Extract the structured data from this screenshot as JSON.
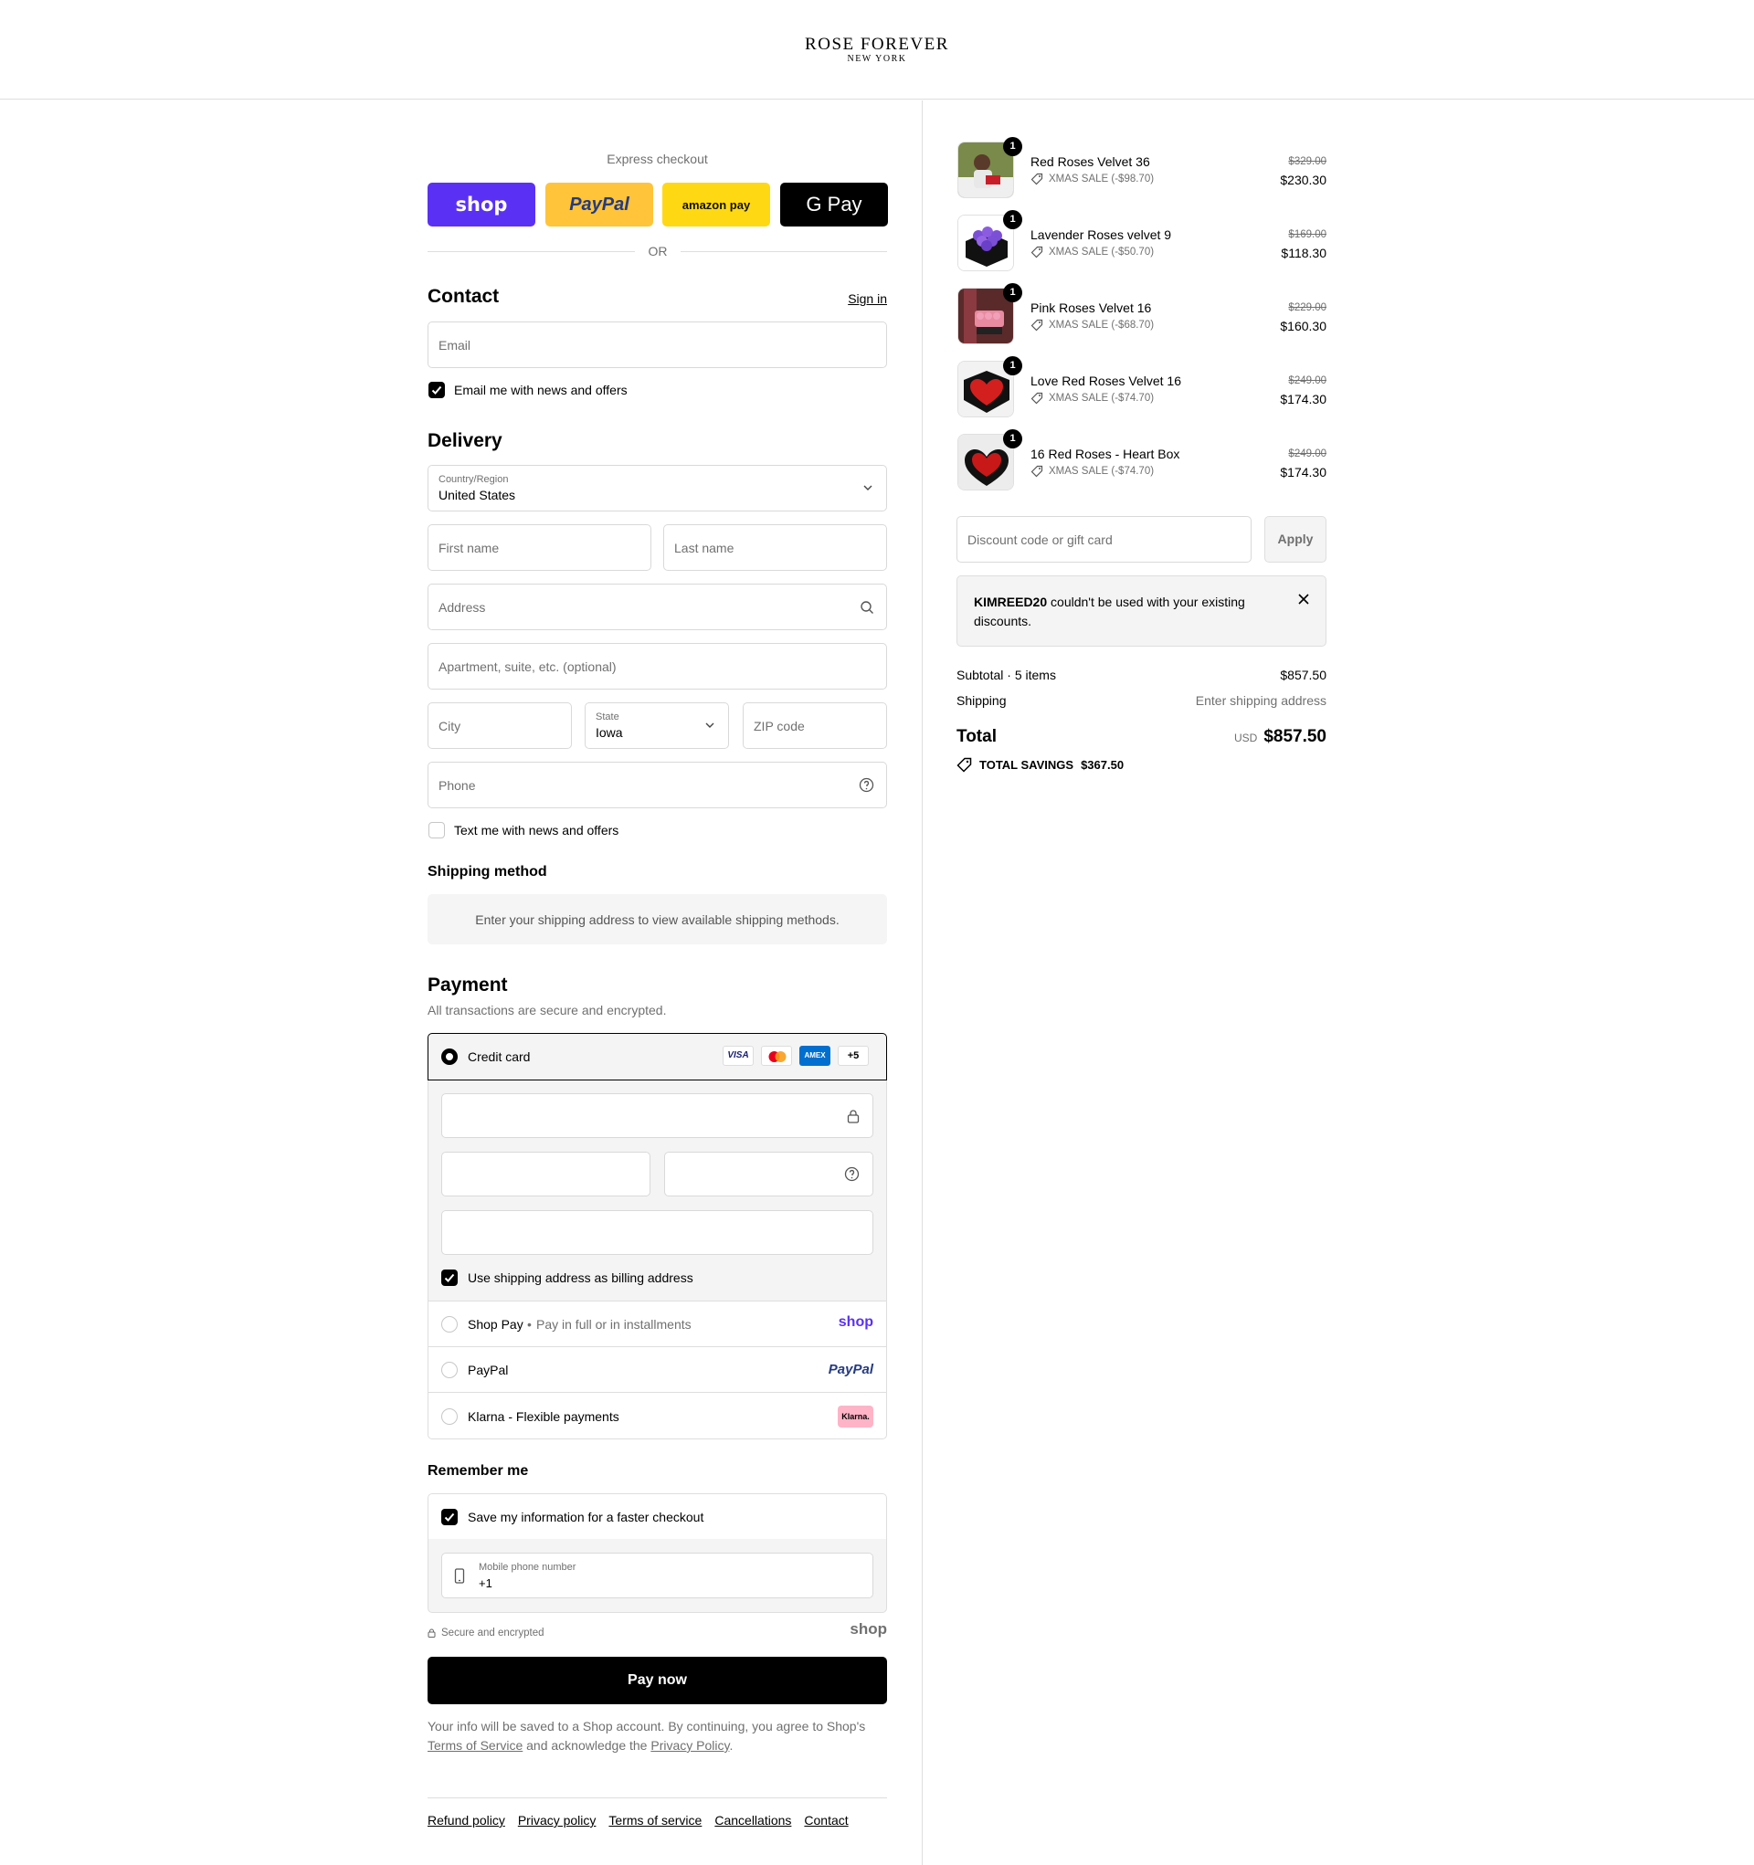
{
  "store": {
    "name": "ROSE FOREVER",
    "sub": "NEW YORK"
  },
  "express": {
    "title": "Express checkout",
    "or": "OR",
    "buttons": [
      {
        "label": "shop",
        "color": "#5a31f4"
      },
      {
        "label": "PayPal",
        "color": "#ffc439"
      },
      {
        "label": "amazon pay",
        "color": "#ffd814"
      },
      {
        "label": "G Pay",
        "color": "#000000"
      }
    ]
  },
  "contact": {
    "title": "Contact",
    "signin": "Sign in",
    "email_placeholder": "Email",
    "news_label": "Email me with news and offers"
  },
  "delivery": {
    "title": "Delivery",
    "country_label": "Country/Region",
    "country_value": "United States",
    "first_name": "First name",
    "last_name": "Last name",
    "address": "Address",
    "apartment": "Apartment, suite, etc. (optional)",
    "city": "City",
    "state_label": "State",
    "state_value": "Iowa",
    "zip": "ZIP code",
    "phone": "Phone",
    "text_label": "Text me with news and offers"
  },
  "shipping": {
    "title": "Shipping method",
    "notice": "Enter your shipping address to view available shipping methods."
  },
  "payment": {
    "title": "Payment",
    "subtitle": "All transactions are secure and encrypted.",
    "credit_card": "Credit card",
    "card_logos": [
      "VISA",
      "MC",
      "AMEX",
      "+5"
    ],
    "billing_label": "Use shipping address as billing address",
    "shoppay": "Shop Pay",
    "shoppay_sub": "Pay in full or in installments",
    "shoppay_logo": "shop",
    "paypal": "PayPal",
    "paypal_logo": "PayPal",
    "klarna": "Klarna - Flexible payments",
    "klarna_logo": "Klarna."
  },
  "remember": {
    "title": "Remember me",
    "save_label": "Save my information for a faster checkout",
    "mobile_label": "Mobile phone number",
    "mobile_value": "+1",
    "secure": "Secure and encrypted",
    "shop_logo": "shop"
  },
  "paynow": "Pay now",
  "legal": {
    "line1": "Your info will be saved to a Shop account. By continuing, you agree to Shop's",
    "terms": "Terms of Service",
    "middle": " and acknowledge the ",
    "privacy": "Privacy Policy",
    "end": "."
  },
  "footer_links": [
    "Refund policy",
    "Privacy policy",
    "Terms of service",
    "Cancellations",
    "Contact"
  ],
  "cart": {
    "items": [
      {
        "name": "Red Roses Velvet 36",
        "sale": "XMAS SALE (-$98.70)",
        "old": "$329.00",
        "price": "$230.30",
        "qty": "1"
      },
      {
        "name": "Lavender Roses velvet 9",
        "sale": "XMAS SALE (-$50.70)",
        "old": "$169.00",
        "price": "$118.30",
        "qty": "1"
      },
      {
        "name": "Pink Roses Velvet 16",
        "sale": "XMAS SALE (-$68.70)",
        "old": "$229.00",
        "price": "$160.30",
        "qty": "1"
      },
      {
        "name": "Love Red Roses Velvet 16",
        "sale": "XMAS SALE (-$74.70)",
        "old": "$249.00",
        "price": "$174.30",
        "qty": "1"
      },
      {
        "name": "16 Red Roses - Heart Box",
        "sale": "XMAS SALE (-$74.70)",
        "old": "$249.00",
        "price": "$174.30",
        "qty": "1"
      }
    ],
    "discount_placeholder": "Discount code or gift card",
    "apply": "Apply",
    "error_code": "KIMREED20",
    "error_msg": " couldn't be used with your existing discounts.",
    "subtotal_label": "Subtotal · 5 items",
    "subtotal": "$857.50",
    "shipping_label": "Shipping",
    "shipping_value": "Enter shipping address",
    "total_label": "Total",
    "currency": "USD",
    "total": "$857.50",
    "savings_label": "TOTAL SAVINGS",
    "savings": "$367.50"
  }
}
